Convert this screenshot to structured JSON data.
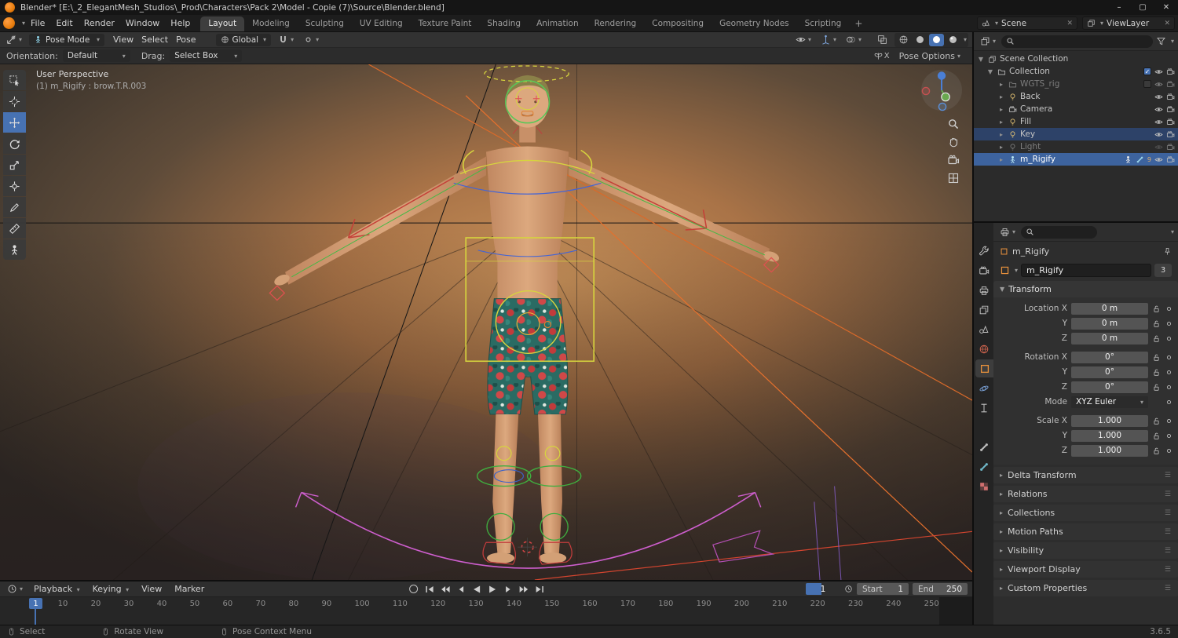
{
  "colors": {
    "accent": "#4772b3",
    "object_orange": "#e8913c",
    "selection_row": "#3d639e",
    "warm_glow": "#c9925a"
  },
  "titlebar": {
    "title": "Blender* [E:\\_2_ElegantMesh_Studios\\_Prod\\Characters\\Pack 2\\Model - Copie (7)\\Source\\Blender.blend]",
    "minimize": "–",
    "maximize": "▢",
    "close": "✕"
  },
  "topbar": {
    "menus": [
      "File",
      "Edit",
      "Render",
      "Window",
      "Help"
    ],
    "workspaces": [
      "Layout",
      "Modeling",
      "Sculpting",
      "UV Editing",
      "Texture Paint",
      "Shading",
      "Animation",
      "Rendering",
      "Compositing",
      "Geometry Nodes",
      "Scripting"
    ],
    "active_workspace": "Layout",
    "new_workspace": "+",
    "scene": "Scene",
    "viewlayer": "ViewLayer"
  },
  "viewport_header": {
    "mode": "Pose Mode",
    "menus": [
      "View",
      "Select",
      "Pose"
    ],
    "orientation": "Global"
  },
  "tool_settings": {
    "orientation_label": "Orientation:",
    "orientation_value": "Default",
    "drag_label": "Drag:",
    "drag_value": "Select Box",
    "mirror_x": "X",
    "pose_options": "Pose Options"
  },
  "viewport": {
    "view_label": "User Perspective",
    "object_label": "(1) m_Rigify : brow.T.R.003"
  },
  "toolbar": {
    "tools": [
      "Tweak",
      "Cursor",
      "Move",
      "Rotate",
      "Scale",
      "Transform",
      "Annotate",
      "Measure",
      "Pose Tool"
    ],
    "active": "Move"
  },
  "outliner": {
    "rows": [
      {
        "label": "Scene Collection"
      },
      {
        "label": "Collection"
      },
      {
        "label": "WGTS_rig"
      },
      {
        "label": "Back"
      },
      {
        "label": "Camera"
      },
      {
        "label": "Fill"
      },
      {
        "label": "Key"
      },
      {
        "label": "Light"
      },
      {
        "label": "m_Rigify",
        "badge": "9"
      }
    ]
  },
  "properties": {
    "breadcrumb": "m_Rigify",
    "name_value": "m_Rigify",
    "name_badge": "3",
    "transform_title": "Transform",
    "location": [
      {
        "label": "Location X",
        "value": "0 m"
      },
      {
        "label": "Y",
        "value": "0 m"
      },
      {
        "label": "Z",
        "value": "0 m"
      }
    ],
    "rotation": [
      {
        "label": "Rotation X",
        "value": "0°"
      },
      {
        "label": "Y",
        "value": "0°"
      },
      {
        "label": "Z",
        "value": "0°"
      }
    ],
    "mode_label": "Mode",
    "mode_value": "XYZ Euler",
    "scale": [
      {
        "label": "Scale X",
        "value": "1.000"
      },
      {
        "label": "Y",
        "value": "1.000"
      },
      {
        "label": "Z",
        "value": "1.000"
      }
    ],
    "sections": [
      "Delta Transform",
      "Relations",
      "Collections",
      "Motion Paths",
      "Visibility",
      "Viewport Display",
      "Custom Properties"
    ]
  },
  "timeline": {
    "menus": [
      "Playback",
      "Keying",
      "View",
      "Marker"
    ],
    "current_frame": "1",
    "start_label": "Start",
    "start_value": "1",
    "end_label": "End",
    "end_value": "250",
    "playhead": "1",
    "ruler": [
      "1",
      "10",
      "20",
      "30",
      "40",
      "50",
      "60",
      "70",
      "80",
      "90",
      "100",
      "110",
      "120",
      "130",
      "140",
      "150",
      "160",
      "170",
      "180",
      "190",
      "200",
      "210",
      "220",
      "230",
      "240",
      "250"
    ]
  },
  "statusbar": {
    "hints": [
      "Select",
      "Rotate View",
      "Pose Context Menu"
    ],
    "version": "3.6.5"
  }
}
